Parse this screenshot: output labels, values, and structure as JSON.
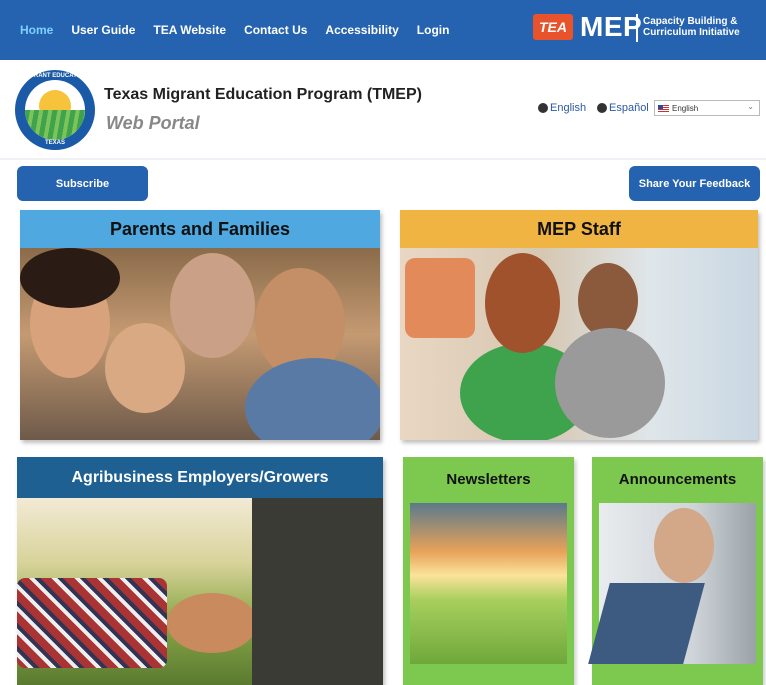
{
  "nav": {
    "links": [
      "Home",
      "User Guide",
      "TEA Website",
      "Contact Us",
      "Accessibility",
      "Login"
    ],
    "tea_logo": "TEA",
    "mep_logo": "MEP",
    "mep_tagline": "Capacity Building & Curriculum Initiative"
  },
  "header": {
    "seal_top": "MIGRANT EDUCATION",
    "seal_bottom": "TEXAS",
    "title": "Texas Migrant Education Program (TMEP)",
    "subtitle": "Web Portal",
    "lang_english": "English",
    "lang_spanish": "Español",
    "lang_select_value": "English"
  },
  "actions": {
    "subscribe": "Subscribe",
    "feedback": "Share Your Feedback"
  },
  "cards": {
    "parents": "Parents and Families",
    "staff": "MEP Staff",
    "agri": "Agribusiness Employers/Growers",
    "newsletters": "Newsletters",
    "announcements": "Announcements"
  },
  "colors": {
    "nav_bg": "#2563b0",
    "parents_head": "#4fa9e0",
    "staff_head": "#f0b443",
    "agri_head": "#1f6093",
    "green_card": "#7dc94f"
  }
}
